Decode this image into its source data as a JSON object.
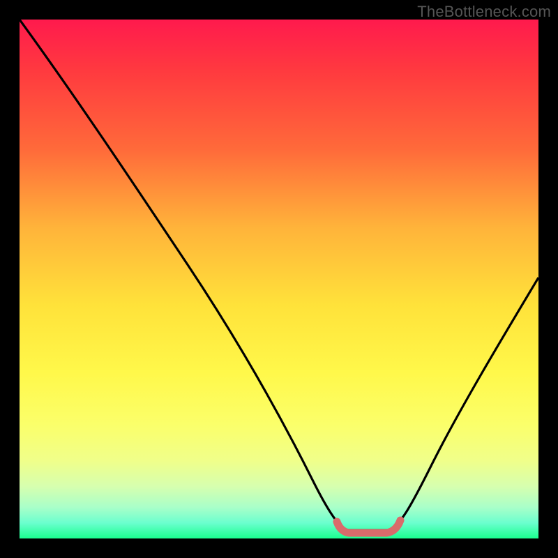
{
  "watermark": "TheBottleneck.com",
  "colors": {
    "frame": "#000000",
    "curve_stroke": "#000000",
    "marker_stroke": "#d96b6b",
    "marker_fill": "#d96b6b"
  },
  "chart_data": {
    "type": "line",
    "title": "",
    "xlabel": "",
    "ylabel": "",
    "xlim": [
      0,
      100
    ],
    "ylim": [
      0,
      100
    ],
    "series": [
      {
        "name": "bottleneck-curve",
        "x": [
          0,
          5,
          10,
          15,
          20,
          25,
          30,
          35,
          40,
          45,
          50,
          55,
          58,
          61,
          64,
          67,
          70,
          72,
          75,
          80,
          85,
          90,
          95,
          100
        ],
        "y": [
          100,
          92,
          84,
          76,
          68,
          60,
          52,
          44,
          36,
          28,
          20,
          12,
          6,
          2,
          0.5,
          0.3,
          0.3,
          0.5,
          3,
          13,
          24,
          34,
          43,
          51
        ]
      }
    ],
    "annotations": [
      {
        "name": "optimal-band",
        "x_range": [
          58,
          71
        ],
        "y": 0.8,
        "label": ""
      }
    ],
    "gradient_stops": [
      {
        "pos": 0,
        "color": "#ff1a4d"
      },
      {
        "pos": 55,
        "color": "#ffe23a"
      },
      {
        "pos": 100,
        "color": "#1aff8f"
      }
    ]
  }
}
